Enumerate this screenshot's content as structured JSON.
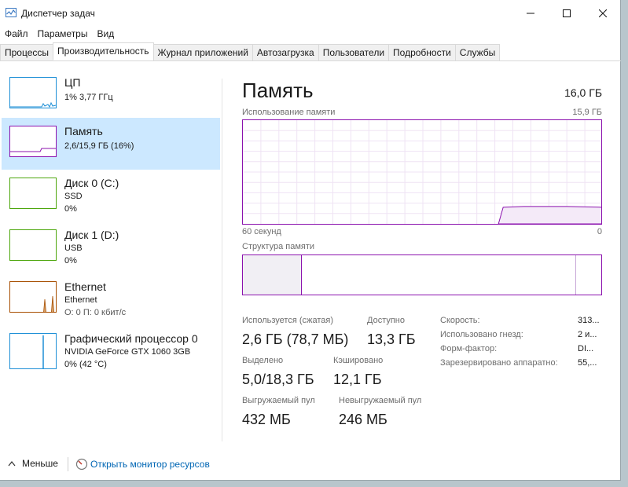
{
  "window": {
    "title": "Диспетчер задач"
  },
  "menu": [
    "Файл",
    "Параметры",
    "Вид"
  ],
  "tabs": [
    "Процессы",
    "Производительность",
    "Журнал приложений",
    "Автозагрузка",
    "Пользователи",
    "Подробности",
    "Службы"
  ],
  "active_tab": 1,
  "sidebar": [
    {
      "name": "ЦП",
      "lines": [
        "1% 3,77 ГГц"
      ],
      "color": "#1e8fd6"
    },
    {
      "name": "Память",
      "lines": [
        "2,6/15,9 ГБ (16%)"
      ],
      "color": "#8b12ae"
    },
    {
      "name": "Диск 0 (C:)",
      "lines": [
        "SSD",
        "0%"
      ],
      "color": "#4da60c"
    },
    {
      "name": "Диск 1 (D:)",
      "lines": [
        "USB",
        "0%"
      ],
      "color": "#4da60c"
    },
    {
      "name": "Ethernet",
      "lines": [
        "Ethernet",
        "О: 0 П: 0 кбит/с"
      ],
      "color": "#a74f01"
    },
    {
      "name": "Графический процессор 0",
      "lines": [
        "NVIDIA GeForce GTX 1060 3GB",
        "0% (42 °C)"
      ],
      "color": "#1e8fd6"
    }
  ],
  "main": {
    "title": "Память",
    "total": "16,0 ГБ",
    "graph_label": "Использование памяти",
    "graph_max": "15,9 ГБ",
    "graph_time_left": "60 секунд",
    "graph_time_right": "0",
    "graph_fill_fraction": 0.16,
    "struct_label": "Структура памяти",
    "graph_color": "#8b12ae",
    "stats": {
      "in_use_label": "Используется (сжатая)",
      "in_use_value": "2,6 ГБ (78,7 МБ)",
      "available_label": "Доступно",
      "available_value": "13,3 ГБ",
      "committed_label": "Выделено",
      "committed_value": "5,0/18,3 ГБ",
      "cached_label": "Кэшировано",
      "cached_value": "12,1 ГБ",
      "paged_label": "Выгружаемый пул",
      "paged_value": "432 МБ",
      "nonpaged_label": "Невыгружаемый пул",
      "nonpaged_value": "246 МБ"
    },
    "details": [
      {
        "label": "Скорость:",
        "value": "313..."
      },
      {
        "label": "Использовано гнезд:",
        "value": "2 и..."
      },
      {
        "label": "Форм-фактор:",
        "value": "DI..."
      },
      {
        "label": "Зарезервировано аппаратно:",
        "value": "55,..."
      }
    ]
  },
  "footer": {
    "less": "Меньше",
    "monitor": "Открыть монитор ресурсов"
  }
}
